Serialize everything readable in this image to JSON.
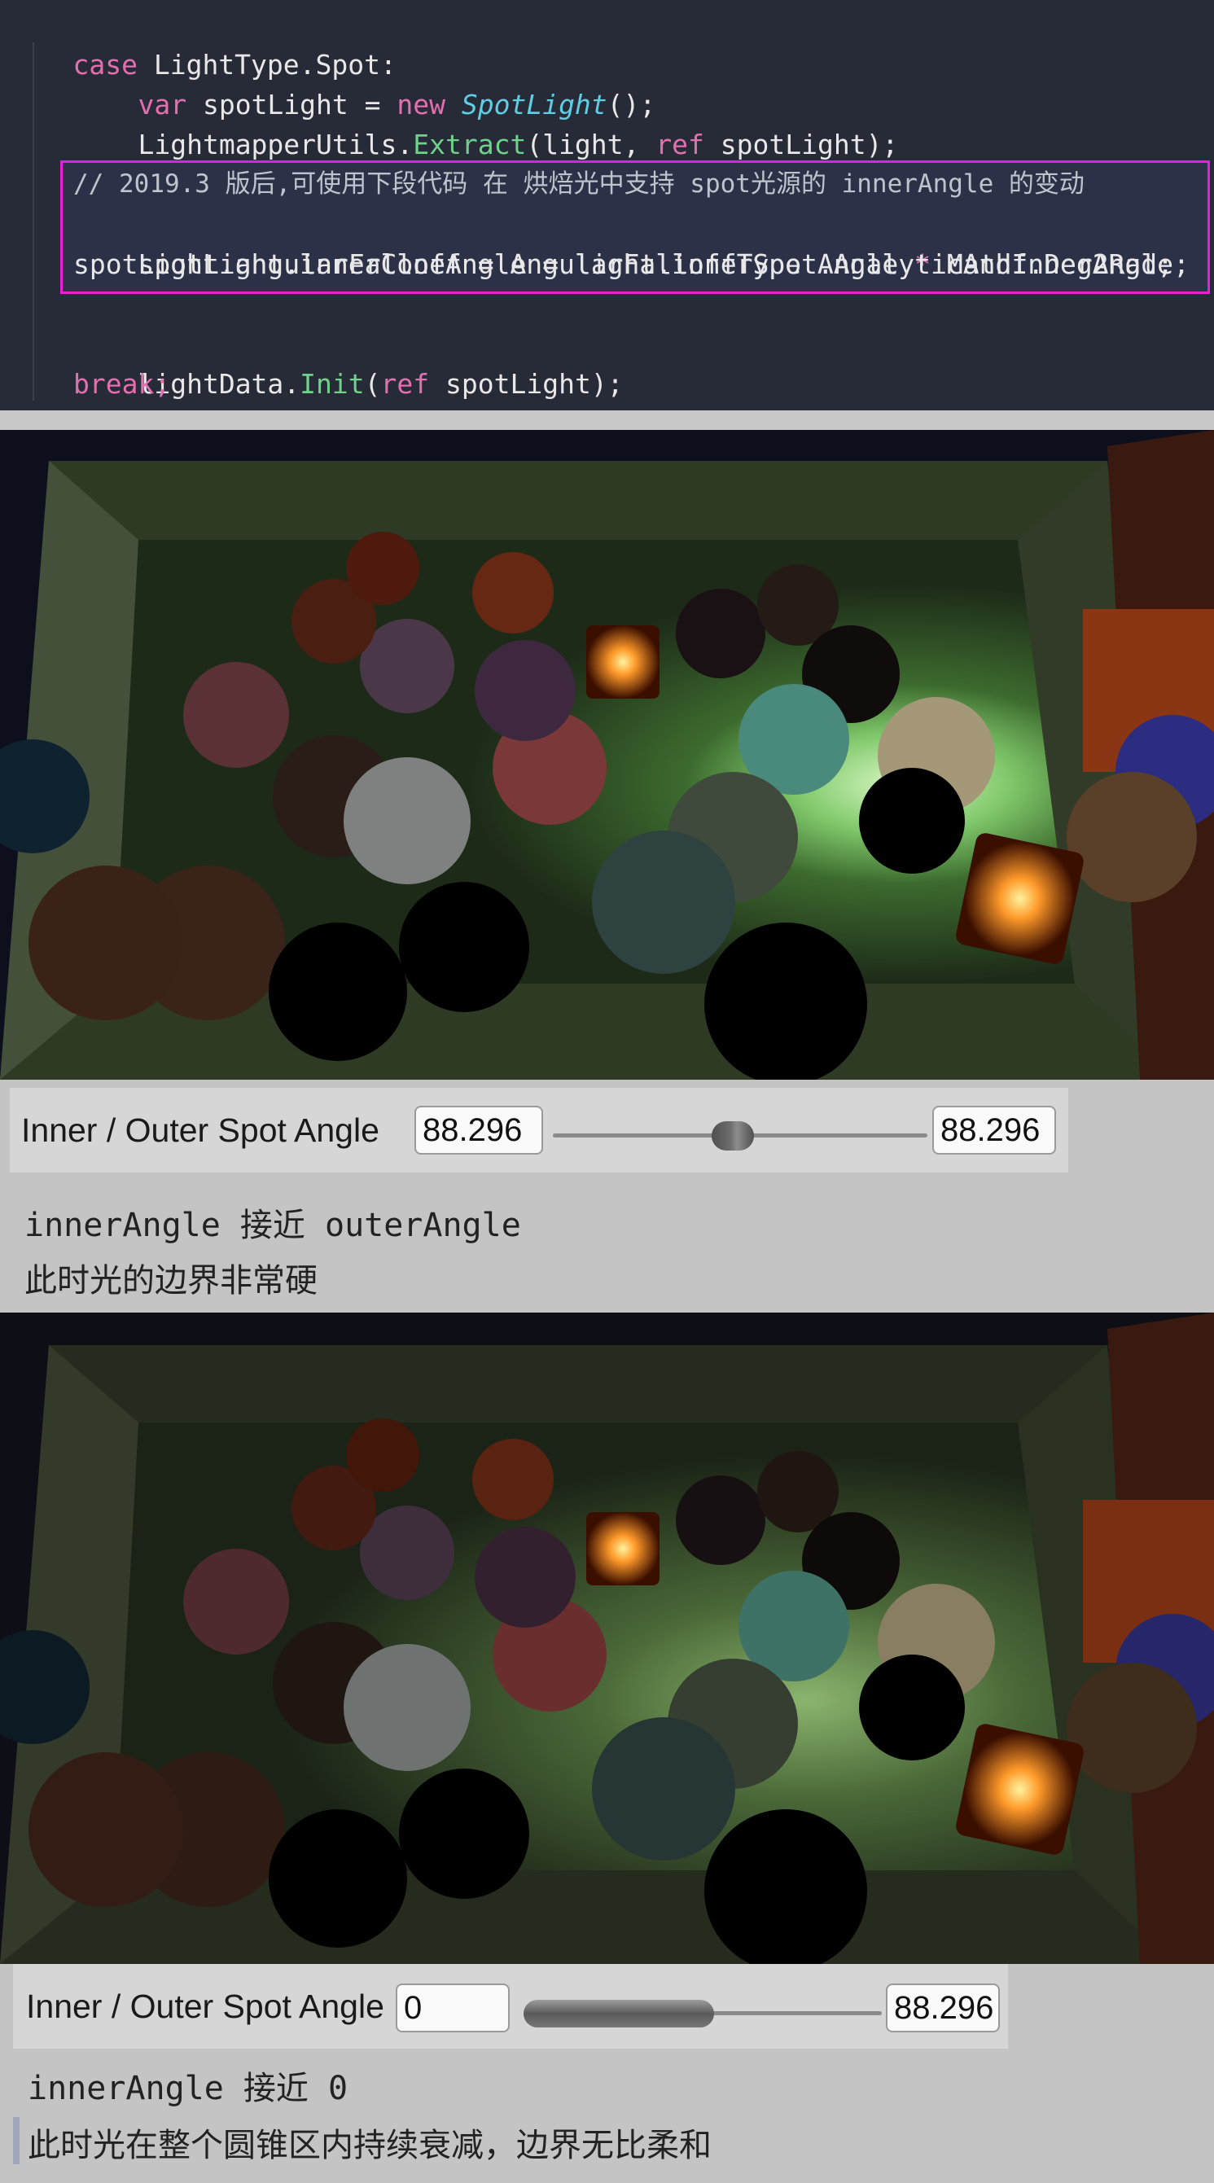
{
  "code": {
    "line1": {
      "kw": "case",
      "rest": " LightType.Spot:"
    },
    "line2": {
      "kw": "var",
      "a": " spotLight = ",
      "kw2": "new",
      "space": " ",
      "type": "SpotLight",
      "end": "();"
    },
    "line3": {
      "a": "LightmapperUtils.",
      "fn": "Extract",
      "b": "(light, ",
      "kw": "ref",
      "c": " spotLight);"
    },
    "line4_comment": "// 2019.3 版后,可使用下段代码 在 烘焙光中支持 spot光源的 innerAngle 的变动",
    "line5": {
      "a": "spotLight.innerConeAngle = light.innerSpotAngle ",
      "op": "*",
      "b": " Mathf.Deg2Rad;"
    },
    "line6": "spotLight.angularFalloff = AngularFalloffType .AnalyticAndInnerAngle;",
    "line7": {
      "a": "lightData.",
      "fn": "Init",
      "b": "(",
      "kw": "ref",
      "c": " spotLight);"
    },
    "line8": "break;"
  },
  "inspector1": {
    "label": "Inner / Outer Spot Angle",
    "inner_value": "88.296",
    "outer_value": "88.296"
  },
  "caption1": {
    "line1": "innerAngle 接近 outerAngle",
    "line2": "此时光的边界非常硬"
  },
  "inspector2": {
    "label": "Inner / Outer Spot Angle",
    "inner_value": "0",
    "outer_value": "88.296"
  },
  "caption2": {
    "line1": "innerAngle 接近 0",
    "line2": "此时光在整个圆锥区内持续衰减，边界无比柔和"
  },
  "colors": {
    "code_bg": "#272b37",
    "keyword": "#e46fb0",
    "type": "#5fcde3",
    "function": "#6ed28a",
    "highlight_border": "#e81ed8"
  }
}
